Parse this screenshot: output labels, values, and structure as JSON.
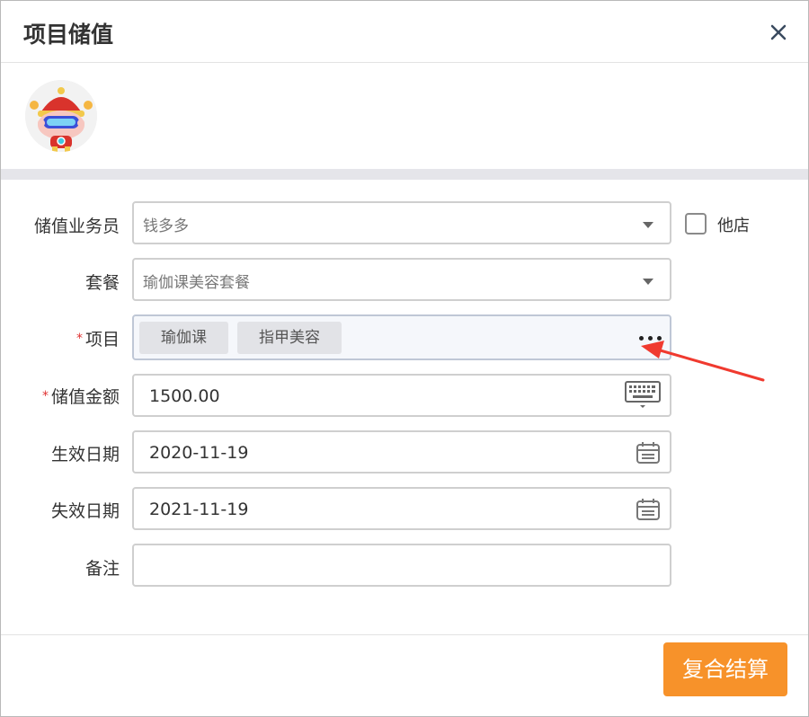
{
  "dialog": {
    "title": "项目储值",
    "close_icon": "close-icon"
  },
  "form": {
    "salesperson": {
      "label": "储值业务员",
      "value": "钱多多"
    },
    "other_store": {
      "label": "他店",
      "checked": false
    },
    "package": {
      "label": "套餐",
      "value": "瑜伽课美容套餐"
    },
    "project": {
      "required_mark": "*",
      "label": "项目",
      "tags": [
        "瑜伽课",
        "指甲美容"
      ]
    },
    "amount": {
      "required_mark": "*",
      "label": "储值金额",
      "value": "1500.00"
    },
    "effective_date": {
      "label": "生效日期",
      "value": "2020-11-19"
    },
    "expiry_date": {
      "label": "失效日期",
      "value": "2021-11-19"
    },
    "remark": {
      "label": "备注",
      "value": ""
    }
  },
  "footer": {
    "settle_button": "复合结算"
  },
  "colors": {
    "accent": "#f7922a",
    "required": "#e03131",
    "annotation_arrow": "#f03a2f"
  }
}
